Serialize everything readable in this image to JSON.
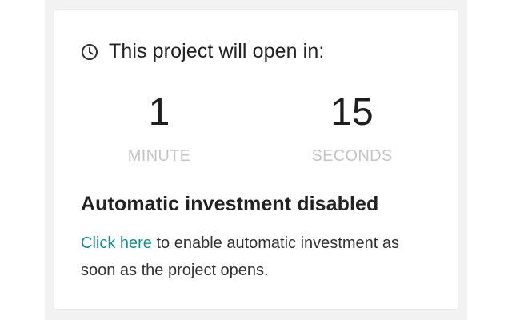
{
  "colors": {
    "accent_link": "#1e8c8c",
    "text_primary": "#222222",
    "text_muted": "#c4c4c4",
    "card_background": "#ffffff",
    "page_background": "#f2f2f2"
  },
  "header": {
    "icon": "clock-icon",
    "title": "This project will open in:"
  },
  "countdown": {
    "minutes": {
      "value": "1",
      "unit": "MINUTE"
    },
    "seconds": {
      "value": "15",
      "unit": "SECONDS"
    }
  },
  "status": {
    "title": "Automatic investment disabled",
    "link_text": "Click here",
    "message": " to enable automatic investment as soon as the project opens."
  }
}
